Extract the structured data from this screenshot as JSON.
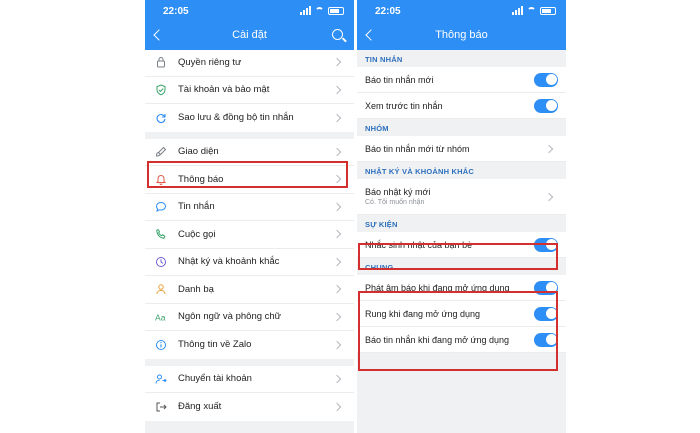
{
  "left": {
    "time": "22:05",
    "title": "Cài đặt",
    "groups": [
      [
        {
          "label": "Quyền riêng tư",
          "icon": "lock-icon"
        },
        {
          "label": "Tài khoản và bảo mật",
          "icon": "shield-icon"
        },
        {
          "label": "Sao lưu & đồng bộ tin nhắn",
          "icon": "backup-icon"
        }
      ],
      [
        {
          "label": "Giao diện",
          "icon": "brush-icon"
        },
        {
          "label": "Thông báo",
          "icon": "bell-icon"
        },
        {
          "label": "Tin nhắn",
          "icon": "chat-icon"
        },
        {
          "label": "Cuộc gọi",
          "icon": "phone-icon"
        },
        {
          "label": "Nhật ký và khoảnh khắc",
          "icon": "clock-icon"
        },
        {
          "label": "Danh bạ",
          "icon": "contact-icon"
        },
        {
          "label": "Ngôn ngữ và phông chữ",
          "icon": "font-icon"
        },
        {
          "label": "Thông tin về Zalo",
          "icon": "info-icon"
        }
      ],
      [
        {
          "label": "Chuyển tài khoản",
          "icon": "switch-user-icon"
        },
        {
          "label": "Đăng xuất",
          "icon": "logout-icon"
        }
      ]
    ]
  },
  "right": {
    "time": "22:05",
    "title": "Thông báo",
    "sections": {
      "tin_nhan": {
        "title": "TIN NHẮN",
        "rows": [
          {
            "label": "Báo tin nhắn mới",
            "control": "toggle",
            "on": true
          },
          {
            "label": "Xem trước tin nhắn",
            "control": "toggle",
            "on": true
          }
        ]
      },
      "nhom": {
        "title": "NHÓM",
        "rows": [
          {
            "label": "Báo tin nhắn mới từ nhóm",
            "control": "chevron"
          }
        ]
      },
      "nhat_ky": {
        "title": "NHẬT KÝ VÀ KHOẢNH KHẮC",
        "rows": [
          {
            "label": "Báo nhật ký mới",
            "sub": "Có. Tôi muốn nhận",
            "control": "chevron"
          }
        ]
      },
      "su_kien": {
        "title": "SỰ KIỆN",
        "rows": [
          {
            "label": "Nhắc sinh nhật của bạn bè",
            "control": "toggle",
            "on": true
          }
        ]
      },
      "chung": {
        "title": "CHUNG",
        "rows": [
          {
            "label": "Phát âm báo khi đang mở ứng dụng",
            "control": "toggle",
            "on": true
          },
          {
            "label": "Rung khi đang mở ứng dụng",
            "control": "toggle",
            "on": true
          },
          {
            "label": "Báo tin nhắn khi đang mở ứng dụng",
            "control": "toggle",
            "on": true
          }
        ]
      }
    }
  },
  "colors": {
    "accent": "#2d8ef5",
    "highlight": "#d32f2f",
    "section_title": "#2d6fbd"
  }
}
